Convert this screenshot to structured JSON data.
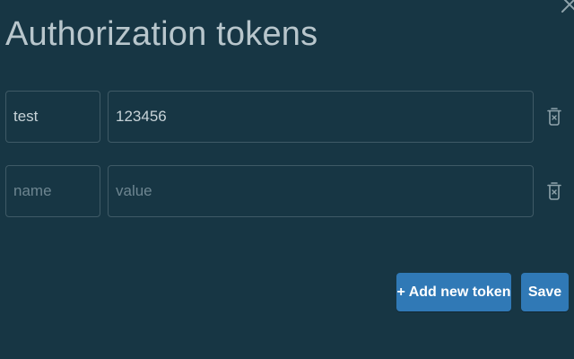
{
  "dialog": {
    "title": "Authorization tokens",
    "close_icon": "close-icon"
  },
  "tokens": [
    {
      "name": "test",
      "value": "123456",
      "name_placeholder": "name",
      "value_placeholder": "value"
    },
    {
      "name": "",
      "value": "",
      "name_placeholder": "name",
      "value_placeholder": "value"
    }
  ],
  "actions": {
    "add_label": "+ Add new token",
    "save_label": "Save"
  },
  "colors": {
    "background": "#173644",
    "button": "#3079b6",
    "border": "#3f5a66",
    "title_text": "#b8c6cc"
  },
  "icons": {
    "delete": "trash-icon",
    "close": "close-icon"
  }
}
